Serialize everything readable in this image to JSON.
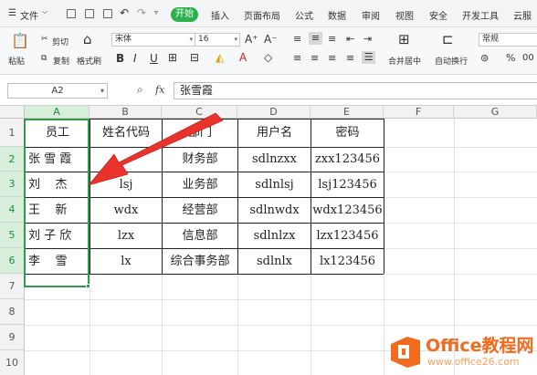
{
  "menubar": {
    "file_menu": "文件",
    "start_tab": "开始",
    "tabs": [
      "插入",
      "页面布局",
      "公式",
      "数据",
      "审阅",
      "视图",
      "安全",
      "开发工具",
      "云服"
    ]
  },
  "ribbon": {
    "cut": "剪切",
    "paste": "粘贴",
    "copy": "复制",
    "format_painter": "格式刷",
    "font_name": "宋体",
    "font_size": "16",
    "grow_font": "A⁺",
    "shrink_font": "A⁻",
    "bold": "B",
    "italic": "I",
    "underline": "U",
    "merge_center": "合并居中",
    "wrap_text": "自动换行",
    "number_format": "常规",
    "percent": "%",
    "thousands": "00"
  },
  "formula_bar": {
    "name_box": "A2",
    "fx": "fx",
    "value": "张雪霞"
  },
  "sheet": {
    "columns": [
      "A",
      "B",
      "C",
      "D",
      "E",
      "F",
      "G"
    ],
    "rows": [
      "1",
      "2",
      "3",
      "4",
      "5",
      "6",
      "7",
      "8",
      "9",
      "10"
    ],
    "header_row": [
      "员工",
      "姓名代码",
      "部门",
      "用户名",
      "密码"
    ],
    "data": [
      [
        "张 雪 霞",
        "",
        "财务部",
        "sdlnzxx",
        "zxx123456"
      ],
      [
        "刘    杰",
        "lsj",
        "业务部",
        "sdlnlsj",
        "lsj123456"
      ],
      [
        "王    新",
        "wdx",
        "经营部",
        "sdlnwdx",
        "wdx123456"
      ],
      [
        "刘 子 欣",
        "lzx",
        "信息部",
        "sdlnlzx",
        "lzx123456"
      ],
      [
        "李    雪",
        "lx",
        "综合事务部",
        "sdlnlx",
        "lx123456"
      ]
    ]
  },
  "watermark": {
    "brand": "Office教程网",
    "url": "www.office26.com"
  },
  "colors": {
    "accent_green": "#2bb24c",
    "selection_green": "#2e9c4b",
    "arrow_red": "#e8322b",
    "watermark_orange": "#f26b1d"
  }
}
